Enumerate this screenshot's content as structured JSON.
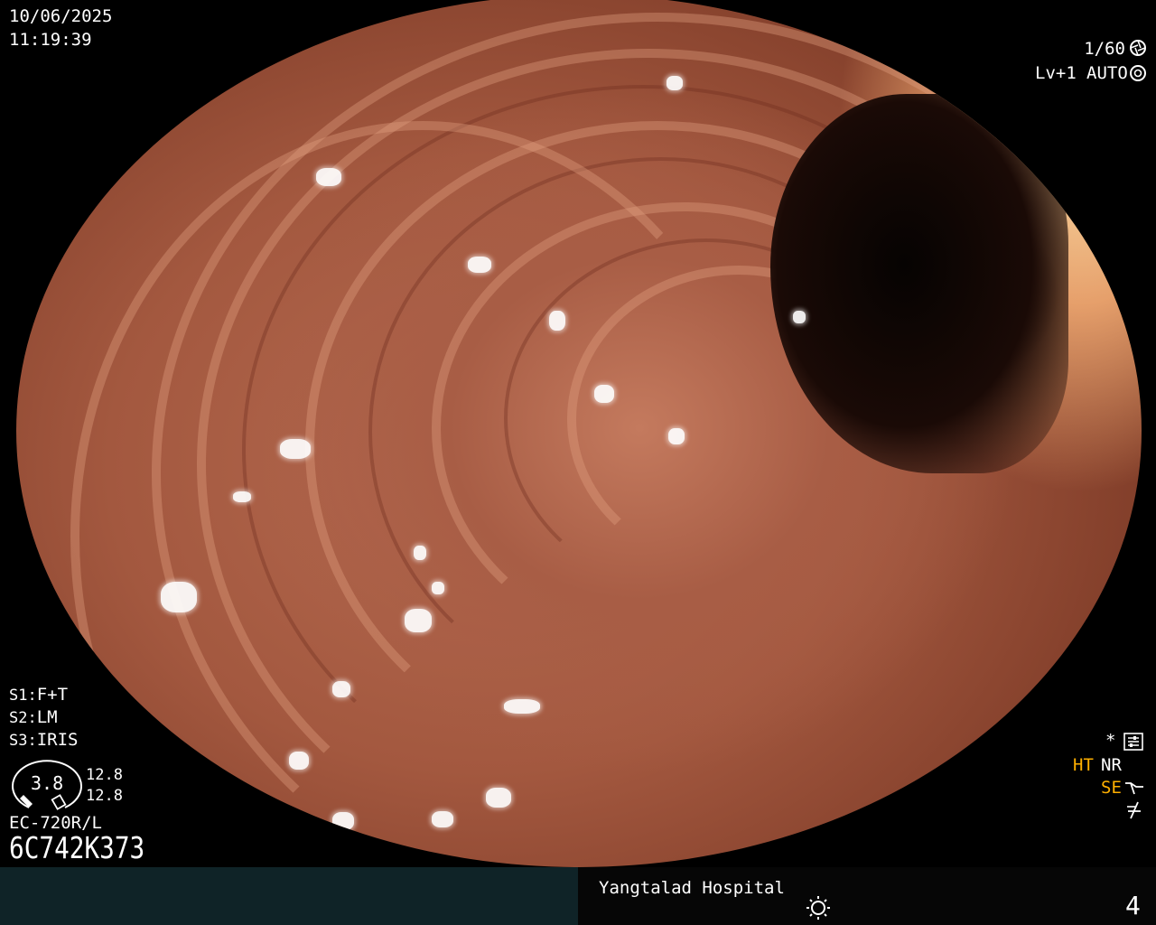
{
  "overlay": {
    "date": "10/06/2025",
    "time": "11:19:39",
    "shutter": "1/60",
    "level": "Lv+1",
    "iris_mode": "AUTO",
    "settings": {
      "s1_label": "S1:",
      "s1_value": "F+T",
      "s2_label": "S2:",
      "s2_value": "LM",
      "s3_label": "S3:",
      "s3_value": "IRIS"
    },
    "zoom": "3.8",
    "scale_top": "12.8",
    "scale_bottom": "12.8",
    "model": "EC-720R/L",
    "serial": "6C742K373",
    "right_indicators": {
      "asterisk": "*",
      "ht": "HT",
      "nr": "NR",
      "se": "SE"
    },
    "hospital": "Yangtalad Hospital",
    "page": "4"
  },
  "icons": {
    "shutter": "aperture-icon",
    "auto": "iris-icon",
    "settings": "settings-panel-icon",
    "se": "structure-enhance-icon",
    "flash": "flash-off-icon",
    "light": "light-icon",
    "scope": "scope-tip-icon"
  },
  "colors": {
    "accent": "#ffb000",
    "bar": "#0f2327"
  }
}
